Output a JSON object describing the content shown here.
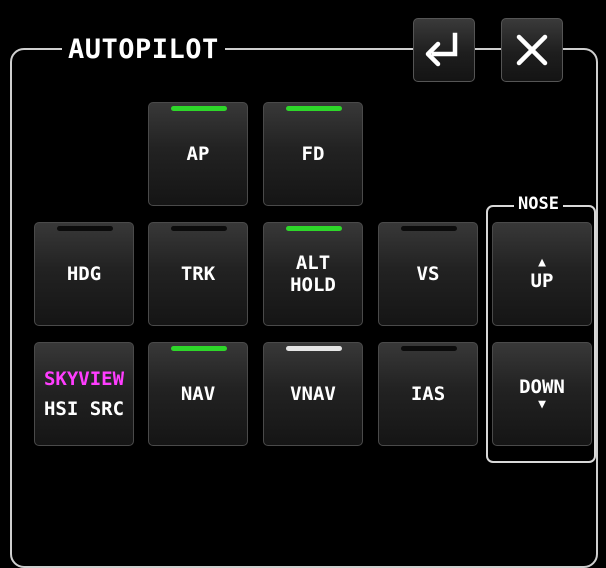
{
  "panel": {
    "title": "AUTOPILOT"
  },
  "header": {
    "enter_icon": "return-arrow-icon",
    "close_icon": "close-x-icon"
  },
  "buttons": {
    "ap": {
      "label": "AP",
      "indicator": "green"
    },
    "fd": {
      "label": "FD",
      "indicator": "green"
    },
    "hdg": {
      "label": "HDG",
      "indicator": "off"
    },
    "trk": {
      "label": "TRK",
      "indicator": "off"
    },
    "alt": {
      "line1": "ALT",
      "line2": "HOLD",
      "indicator": "green"
    },
    "vs": {
      "label": "VS",
      "indicator": "off"
    },
    "hsi": {
      "line1": "SKYVIEW",
      "line2": "HSI SRC"
    },
    "nav": {
      "label": "NAV",
      "indicator": "green"
    },
    "vnav": {
      "label": "VNAV",
      "indicator": "white"
    },
    "ias": {
      "label": "IAS",
      "indicator": "off"
    }
  },
  "nose": {
    "title": "NOSE",
    "up": {
      "arrow": "▲",
      "label": "UP"
    },
    "down": {
      "label": "DOWN",
      "arrow": "▼"
    }
  },
  "colors": {
    "indicator_on": "#2ed72a",
    "indicator_white": "#e6e6e6",
    "skyview": "#ff3dff",
    "frame": "#cfcfcf"
  }
}
